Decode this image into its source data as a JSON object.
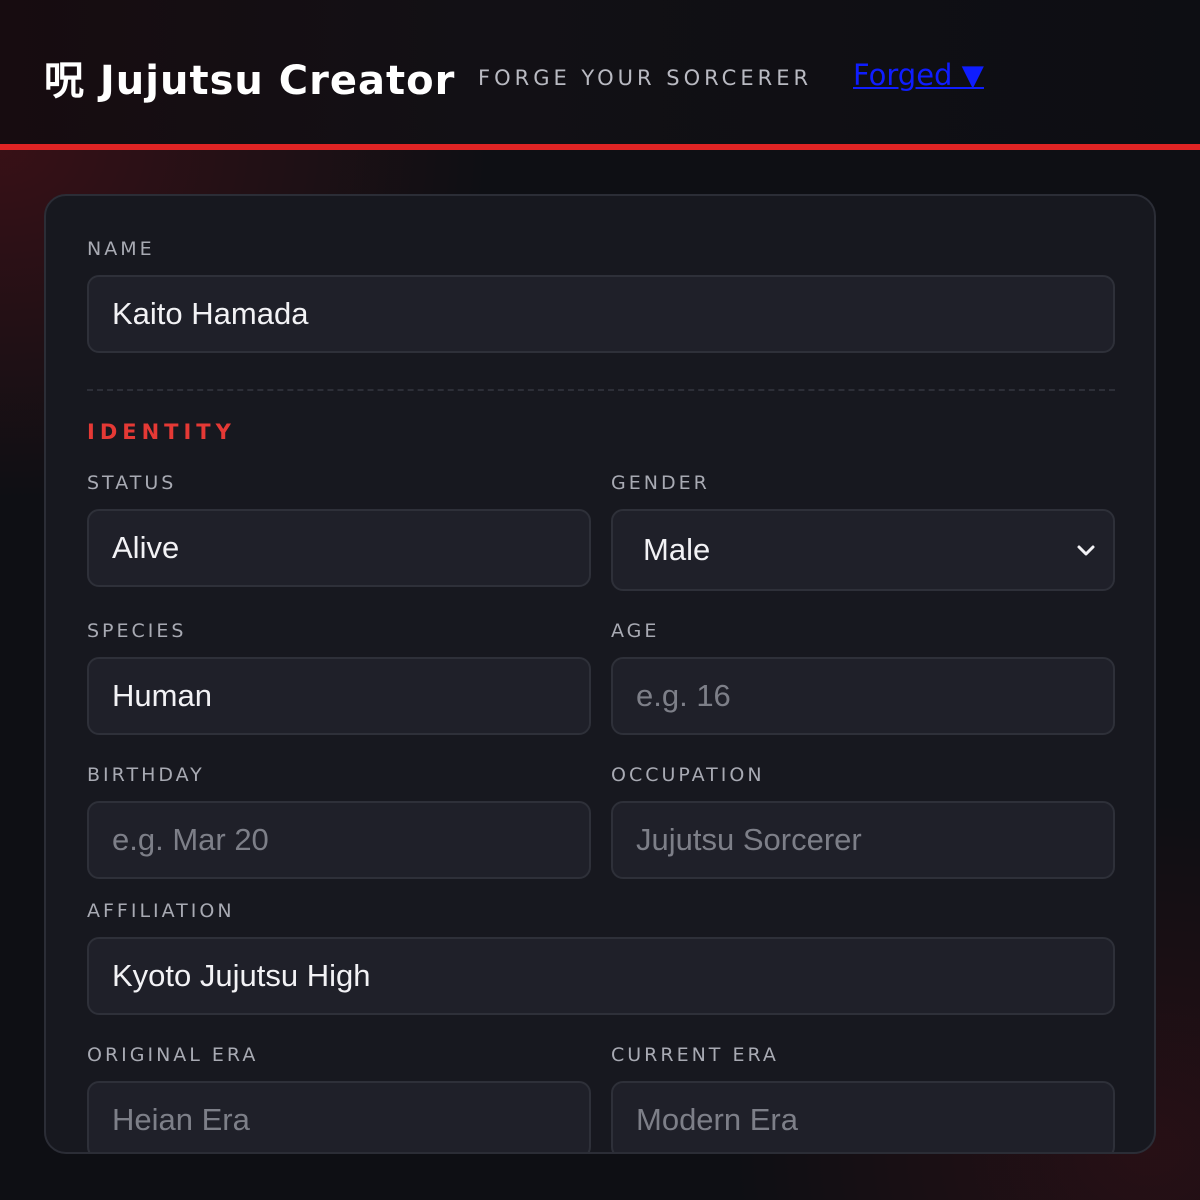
{
  "header": {
    "logo": "呪 Jujutsu Creator",
    "tagline": "FORGE YOUR SORCERER",
    "forged_link": "Forged ▼"
  },
  "form": {
    "name": {
      "label": "NAME",
      "value": "Kaito Hamada"
    },
    "identity_section": "IDENTITY",
    "status": {
      "label": "STATUS",
      "value": "Alive"
    },
    "gender": {
      "label": "GENDER",
      "selected": "Male",
      "icon": "chevron-down-icon"
    },
    "species": {
      "label": "SPECIES",
      "value": "Human"
    },
    "age": {
      "label": "AGE",
      "placeholder": "e.g. 16"
    },
    "birthday": {
      "label": "BIRTHDAY",
      "placeholder": "e.g. Mar 20"
    },
    "occupation": {
      "label": "OCCUPATION",
      "placeholder": "Jujutsu Sorcerer"
    },
    "affiliation": {
      "label": "AFFILIATION",
      "value": "Kyoto Jujutsu High"
    },
    "original_era": {
      "label": "ORIGINAL ERA",
      "placeholder": "Heian Era"
    },
    "current_era": {
      "label": "CURRENT ERA",
      "placeholder": "Modern Era"
    }
  },
  "colors": {
    "accent": "#e53935",
    "header_line": "#e02424",
    "link": "#0f1dff",
    "card_bg": "#17181f",
    "field_bg": "#1f2029"
  }
}
